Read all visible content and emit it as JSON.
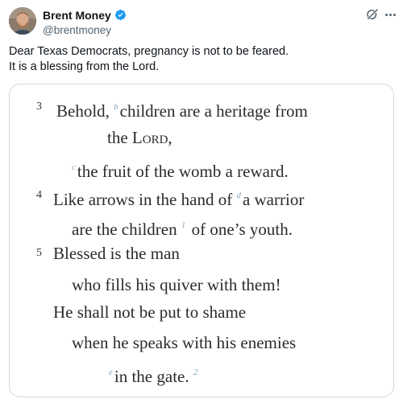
{
  "author": {
    "display_name": "Brent Money",
    "handle": "@brentmoney",
    "verified": true,
    "avatar": "user-avatar-photo"
  },
  "actions": {
    "grok_icon": "grok-icon",
    "more_icon": "more-options-icon"
  },
  "tweet": {
    "line1": "Dear Texas Democrats, pregnancy is not to be feared.",
    "line2": "It is a blessing from the Lord."
  },
  "scripture": {
    "verse3_num": "3",
    "verse4_num": "4",
    "verse5_num": "5",
    "fn_b": "b",
    "fn_c": "c",
    "fn_d": "d",
    "fn_1": "1",
    "fn_e": "e",
    "fn_2": "2",
    "l1": "Behold,",
    "l1b": "children are a heritage from",
    "l2a": "the",
    "l2b": "Lord",
    "l2c": ",",
    "l3": "the fruit of the womb a reward.",
    "l4a": "Like arrows in the hand of",
    "l4b": "a warrior",
    "l5a": "are the children",
    "l5b": "of one’s youth.",
    "l6": "Blessed is the man",
    "l7": "who fills his quiver with them!",
    "l8": "He shall not be put to shame",
    "l9": "when he speaks with his enemies",
    "l10": "in the gate."
  },
  "colors": {
    "verified_blue": "#1d9bf0",
    "handle_gray": "#536471",
    "footnote_blue": "#8aa7bd"
  }
}
